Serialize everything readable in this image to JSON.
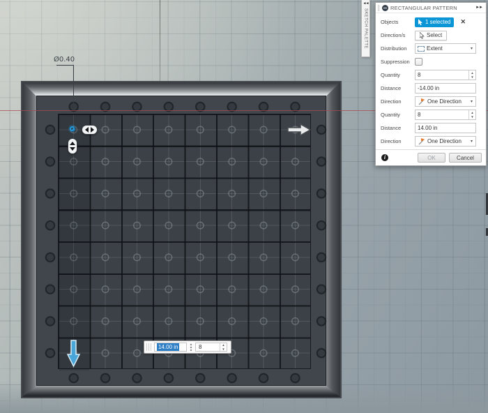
{
  "canvas": {
    "dimension_label": "Ø0.40",
    "inline_editor": {
      "distance_value": "14.00 in",
      "quantity_value": "8"
    }
  },
  "sketch_palette": {
    "title": "SKETCH PALETTE"
  },
  "icons": {
    "collapse_left": "◄◄",
    "expand_right": "►►",
    "close": "✕",
    "caret_down": "▾",
    "spin_up": "▲",
    "spin_down": "▼",
    "info": "i"
  },
  "dialog": {
    "title": "RECTANGULAR PATTERN",
    "fields": {
      "objects": {
        "label": "Objects",
        "value": "1 selected"
      },
      "directions": {
        "label": "Direction/s",
        "value": "Select"
      },
      "distribution": {
        "label": "Distribution",
        "value": "Extent"
      },
      "suppression": {
        "label": "Suppression",
        "checked": false
      },
      "quantity1": {
        "label": "Quantity",
        "value": "8"
      },
      "distance1": {
        "label": "Distance",
        "value": "-14.00 in"
      },
      "direction1": {
        "label": "Direction",
        "value": "One Direction"
      },
      "quantity2": {
        "label": "Quantity",
        "value": "8"
      },
      "distance2": {
        "label": "Distance",
        "value": "14.00 in"
      },
      "direction2": {
        "label": "Direction",
        "value": "One Direction"
      }
    },
    "buttons": {
      "ok": "OK",
      "cancel": "Cancel"
    },
    "colors": {
      "accent_blue": "#0a96d6",
      "selection_blue": "#2e7fc6",
      "axis_red": "#a84a4f",
      "direction_arrow_blue": "#4aa6d8"
    }
  }
}
